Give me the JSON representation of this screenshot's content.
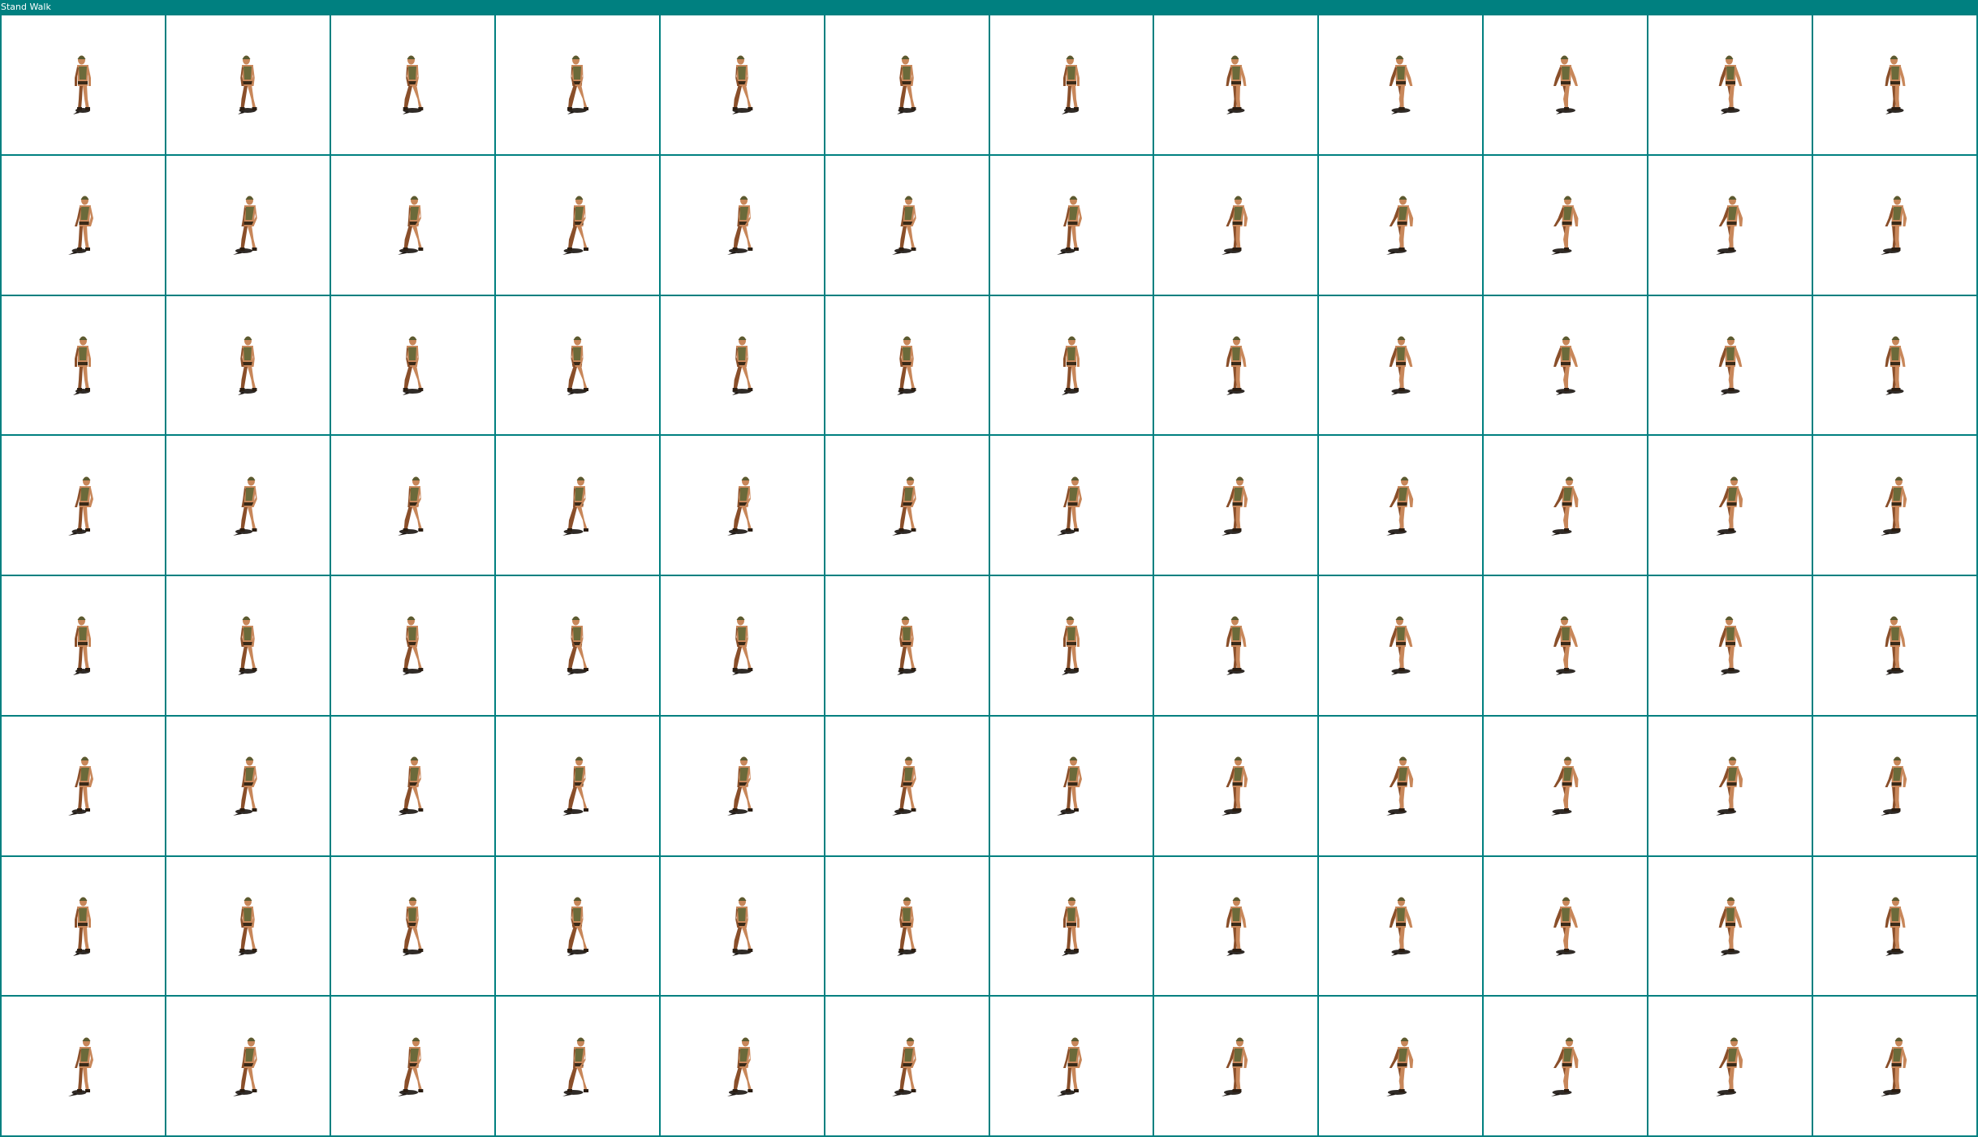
{
  "window": {
    "title": "Stand Walk"
  },
  "sheet": {
    "columns": 12,
    "rows": 8,
    "grid_color": "#008080",
    "background_color": "#ffffff",
    "sprite": {
      "subject": "walking-soldier-sprite",
      "skin_color": "#c8875a",
      "skin_dark_color": "#8a4f2a",
      "vest_color": "#6b6a3a",
      "helmet_color": "#5a5a30",
      "shadow_color": "#1a1410"
    },
    "directions": [
      "dir-0",
      "dir-1",
      "dir-2",
      "dir-3",
      "dir-4",
      "dir-5",
      "dir-6",
      "dir-7"
    ]
  }
}
